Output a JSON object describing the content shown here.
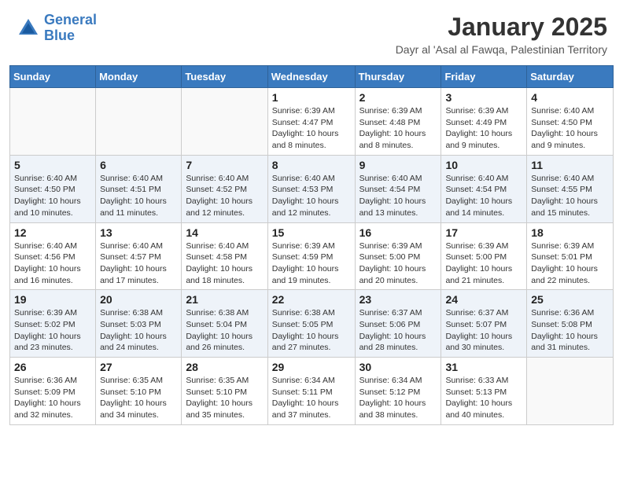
{
  "header": {
    "logo_line1": "General",
    "logo_line2": "Blue",
    "title": "January 2025",
    "subtitle": "Dayr al 'Asal al Fawqa, Palestinian Territory"
  },
  "days": [
    "Sunday",
    "Monday",
    "Tuesday",
    "Wednesday",
    "Thursday",
    "Friday",
    "Saturday"
  ],
  "weeks": [
    [
      {
        "date": "",
        "info": ""
      },
      {
        "date": "",
        "info": ""
      },
      {
        "date": "",
        "info": ""
      },
      {
        "date": "1",
        "info": "Sunrise: 6:39 AM\nSunset: 4:47 PM\nDaylight: 10 hours and 8 minutes."
      },
      {
        "date": "2",
        "info": "Sunrise: 6:39 AM\nSunset: 4:48 PM\nDaylight: 10 hours and 8 minutes."
      },
      {
        "date": "3",
        "info": "Sunrise: 6:39 AM\nSunset: 4:49 PM\nDaylight: 10 hours and 9 minutes."
      },
      {
        "date": "4",
        "info": "Sunrise: 6:40 AM\nSunset: 4:50 PM\nDaylight: 10 hours and 9 minutes."
      }
    ],
    [
      {
        "date": "5",
        "info": "Sunrise: 6:40 AM\nSunset: 4:50 PM\nDaylight: 10 hours and 10 minutes."
      },
      {
        "date": "6",
        "info": "Sunrise: 6:40 AM\nSunset: 4:51 PM\nDaylight: 10 hours and 11 minutes."
      },
      {
        "date": "7",
        "info": "Sunrise: 6:40 AM\nSunset: 4:52 PM\nDaylight: 10 hours and 12 minutes."
      },
      {
        "date": "8",
        "info": "Sunrise: 6:40 AM\nSunset: 4:53 PM\nDaylight: 10 hours and 12 minutes."
      },
      {
        "date": "9",
        "info": "Sunrise: 6:40 AM\nSunset: 4:54 PM\nDaylight: 10 hours and 13 minutes."
      },
      {
        "date": "10",
        "info": "Sunrise: 6:40 AM\nSunset: 4:54 PM\nDaylight: 10 hours and 14 minutes."
      },
      {
        "date": "11",
        "info": "Sunrise: 6:40 AM\nSunset: 4:55 PM\nDaylight: 10 hours and 15 minutes."
      }
    ],
    [
      {
        "date": "12",
        "info": "Sunrise: 6:40 AM\nSunset: 4:56 PM\nDaylight: 10 hours and 16 minutes."
      },
      {
        "date": "13",
        "info": "Sunrise: 6:40 AM\nSunset: 4:57 PM\nDaylight: 10 hours and 17 minutes."
      },
      {
        "date": "14",
        "info": "Sunrise: 6:40 AM\nSunset: 4:58 PM\nDaylight: 10 hours and 18 minutes."
      },
      {
        "date": "15",
        "info": "Sunrise: 6:39 AM\nSunset: 4:59 PM\nDaylight: 10 hours and 19 minutes."
      },
      {
        "date": "16",
        "info": "Sunrise: 6:39 AM\nSunset: 5:00 PM\nDaylight: 10 hours and 20 minutes."
      },
      {
        "date": "17",
        "info": "Sunrise: 6:39 AM\nSunset: 5:00 PM\nDaylight: 10 hours and 21 minutes."
      },
      {
        "date": "18",
        "info": "Sunrise: 6:39 AM\nSunset: 5:01 PM\nDaylight: 10 hours and 22 minutes."
      }
    ],
    [
      {
        "date": "19",
        "info": "Sunrise: 6:39 AM\nSunset: 5:02 PM\nDaylight: 10 hours and 23 minutes."
      },
      {
        "date": "20",
        "info": "Sunrise: 6:38 AM\nSunset: 5:03 PM\nDaylight: 10 hours and 24 minutes."
      },
      {
        "date": "21",
        "info": "Sunrise: 6:38 AM\nSunset: 5:04 PM\nDaylight: 10 hours and 26 minutes."
      },
      {
        "date": "22",
        "info": "Sunrise: 6:38 AM\nSunset: 5:05 PM\nDaylight: 10 hours and 27 minutes."
      },
      {
        "date": "23",
        "info": "Sunrise: 6:37 AM\nSunset: 5:06 PM\nDaylight: 10 hours and 28 minutes."
      },
      {
        "date": "24",
        "info": "Sunrise: 6:37 AM\nSunset: 5:07 PM\nDaylight: 10 hours and 30 minutes."
      },
      {
        "date": "25",
        "info": "Sunrise: 6:36 AM\nSunset: 5:08 PM\nDaylight: 10 hours and 31 minutes."
      }
    ],
    [
      {
        "date": "26",
        "info": "Sunrise: 6:36 AM\nSunset: 5:09 PM\nDaylight: 10 hours and 32 minutes."
      },
      {
        "date": "27",
        "info": "Sunrise: 6:35 AM\nSunset: 5:10 PM\nDaylight: 10 hours and 34 minutes."
      },
      {
        "date": "28",
        "info": "Sunrise: 6:35 AM\nSunset: 5:10 PM\nDaylight: 10 hours and 35 minutes."
      },
      {
        "date": "29",
        "info": "Sunrise: 6:34 AM\nSunset: 5:11 PM\nDaylight: 10 hours and 37 minutes."
      },
      {
        "date": "30",
        "info": "Sunrise: 6:34 AM\nSunset: 5:12 PM\nDaylight: 10 hours and 38 minutes."
      },
      {
        "date": "31",
        "info": "Sunrise: 6:33 AM\nSunset: 5:13 PM\nDaylight: 10 hours and 40 minutes."
      },
      {
        "date": "",
        "info": ""
      }
    ]
  ]
}
